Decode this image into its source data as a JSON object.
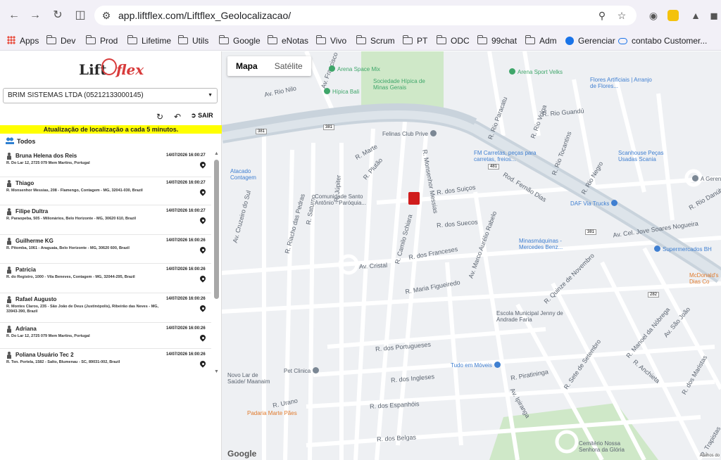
{
  "browser": {
    "url": "app.liftflex.com/Liftflex_Geolocalizacao/",
    "bookmarks": [
      "Apps",
      "Dev",
      "Prod",
      "Lifetime",
      "Utils",
      "Google",
      "eNotas",
      "Vivo",
      "Scrum",
      "PT",
      "ODC",
      "99chat",
      "Adm",
      "Gerenciar",
      "contabo Customer..."
    ]
  },
  "panel": {
    "logo_left": "Lift",
    "logo_right": "flex",
    "company_select": "BRIM SISTEMAS LTDA (05212133000145)",
    "sair_label": "SAIR",
    "banner": "Atualização de localização a cada 5 minutos.",
    "todos_label": "Todos",
    "users": [
      {
        "name": "Bruna Helena dos Reis",
        "time": "14/07/2026 16:00:27",
        "address": "R. Do Lar 12, 2725 079 Mem Martins, Portugal"
      },
      {
        "name": "Thiago",
        "time": "14/07/2026 16:00:27",
        "address": "R. Monsenhor Messias, 208 - Flamengo, Contagem - MG, 32041-030, Brazil"
      },
      {
        "name": "Filipe Dultra",
        "time": "14/07/2026 16:00:27",
        "address": "R. Paraopeba, 505 - Milionários, Belo Horizonte - MG, 30620 610, Brazil"
      },
      {
        "name": "Guilherme KG",
        "time": "14/07/2026 16:00:26",
        "address": "R. Pitomba, 1061 - Araguaia, Belo Horizonte - MG, 30620 600, Brazil"
      },
      {
        "name": "Patricia",
        "time": "14/07/2026 16:00:26",
        "address": "R. do Registro, 1000 - Vila Beneves, Contagem - MG, 32044-295, Brazil"
      },
      {
        "name": "Rafael Augusto",
        "time": "14/07/2026 16:00:26",
        "address": "R. Montes Claros, 235 - São João de Deus (Justinópolis), Ribeirão das Neves - MG, 33943-390, Brazil"
      },
      {
        "name": "Adriana",
        "time": "14/07/2026 16:00:26",
        "address": "R. Do Lar 12, 2725 079 Mem Martins, Portugal"
      },
      {
        "name": "Poliana Usuário Tec 2",
        "time": "14/07/2026 16:00:26",
        "address": "R. Ten. Portela, 1582 - Salto, Blumenau - SC, 89031-002, Brazil"
      }
    ]
  },
  "map": {
    "type_tabs": [
      "Mapa",
      "Satélite"
    ],
    "active_tab": "Mapa",
    "streets": [
      "Av. Francisco",
      "Av. Rio Nilo",
      "R. Rio Paracatu",
      "R. Rio Volga",
      "R. Rio Guandú",
      "R. Rio Tocantins",
      "R. Rio Negro",
      "Rod. Fernão Dias",
      "R. Monsenhor Messias",
      "R. Marte",
      "R. Plutão",
      "R. dos Suiços",
      "R. dos Suecos",
      "Av. Cruzeiro do Sul",
      "R. Riacho das Pedras",
      "R. Saturno",
      "R. Júpiter",
      "R. Camilo Schiara",
      "Av. Marco Aurélio Rabelo",
      "R. dos Franceses",
      "Av. Cristal",
      "R. Maria Figueiredo",
      "R. dos Portugueses",
      "R. dos Ingleses",
      "R. dos Espanhóis",
      "R. dos Belgas",
      "R. Urano",
      "R. Piratininga",
      "Av. Ipiranga",
      "R. Sete de Setembro",
      "R. Quinze de Novembro",
      "R. Manoel da Nóbrega",
      "Av. São João",
      "R. dos Maristas",
      "R. Anchieta",
      "Av. Cel. Jove Soares Nogueira",
      "R. Rio Danúbio",
      "R. Trapistas"
    ],
    "pois": [
      {
        "name": "Arena Space Mix",
        "color": "#3fa66a"
      },
      {
        "name": "Hípica Bali",
        "color": "#3fa66a"
      },
      {
        "name": "Sociedade Hípica de Minas Gerais",
        "color": "#3fa66a"
      },
      {
        "name": "Arena Sport Velks",
        "color": "#3fa66a"
      },
      {
        "name": "Flores Artificiais | Arranjo de Flores...",
        "color": "#3f7fd1"
      },
      {
        "name": "Felinas Club Prive",
        "color": "#7b8794"
      },
      {
        "name": "FM Carretas, peças para carretas, freios...",
        "color": "#3f7fd1"
      },
      {
        "name": "Scanhouse Peças Usadas Scania",
        "color": "#3f7fd1"
      },
      {
        "name": "A Gerencial",
        "color": "#7b8794"
      },
      {
        "name": "Atacado Contagem",
        "color": "#3f7fd1"
      },
      {
        "name": "Comunidade Santo Antônio - Paróquia...",
        "color": "#7b8794"
      },
      {
        "name": "DAF Via Trucks",
        "color": "#3f7fd1"
      },
      {
        "name": "Minasmáquinas - Mercedes Benz...",
        "color": "#3f7fd1"
      },
      {
        "name": "Supermercados BH",
        "color": "#3f7fd1"
      },
      {
        "name": "McDonald's Dias Co",
        "color": "#f08c3c"
      },
      {
        "name": "Escola Municipal Jenny de Andrade Faria",
        "color": "#7b8794"
      },
      {
        "name": "Tudo em Móveis",
        "color": "#3f7fd1"
      },
      {
        "name": "Pet Clinica",
        "color": "#7b8794"
      },
      {
        "name": "Novo Lar de Saúde/ Maanaim",
        "color": "#d23c3c"
      },
      {
        "name": "Padaria Marte Pães",
        "color": "#f08c3c"
      },
      {
        "name": "Cemitério Nossa Senhora da Glória",
        "color": "#7b8794"
      }
    ],
    "route_badges": [
      "381",
      "381",
      "481",
      "381",
      "282"
    ],
    "logo": "Google",
    "attribution": "Atalhos do"
  },
  "colors": {
    "banner_bg": "#ffff00",
    "brand_red": "#d83b3b",
    "highway": "#c9d3dc",
    "park": "#cfe8c8"
  }
}
